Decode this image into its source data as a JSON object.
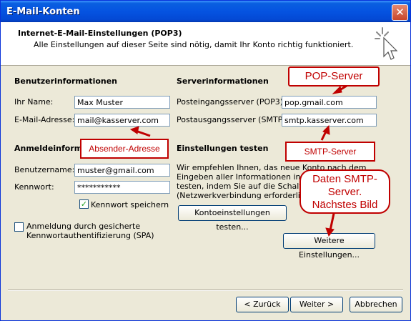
{
  "window": {
    "title": "E-Mail-Konten",
    "close_label": "✕"
  },
  "header": {
    "title": "Internet-E-Mail-Einstellungen (POP3)",
    "subtitle": "Alle Einstellungen auf dieser Seite sind nötig, damit Ihr Konto richtig funktioniert."
  },
  "user_info": {
    "heading": "Benutzerinformationen",
    "name_label": "Ihr Name:",
    "name_value": "Max Muster",
    "email_label": "E-Mail-Adresse:",
    "email_value": "mail@kasserver.com"
  },
  "server_info": {
    "heading": "Serverinformationen",
    "incoming_label": "Posteingangsserver (POP3):",
    "incoming_value": "pop.gmail.com",
    "outgoing_label": "Postausgangsserver (SMTP):",
    "outgoing_value": "smtp.kasserver.com"
  },
  "login_info": {
    "heading": "Anmeldeinforma",
    "username_label": "Benutzername:",
    "username_value": "muster@gmail.com",
    "password_label": "Kennwort:",
    "password_value": "***********",
    "remember_label": "Kennwort speichern",
    "spa_label_line1": "Anmeldung durch gesicherte",
    "spa_label_line2": "Kennwortauthentifizierung (SPA)"
  },
  "test_settings": {
    "heading": "Einstellungen testen",
    "text_line1": "Wir empfehlen Ihnen, das neue Konto nach dem",
    "text_line2": "Eingeben aller Informationen in die",
    "text_line3": "testen, indem Sie auf die Schaltflä",
    "text_line4": "(Netzwerkverbindung erforderlich).",
    "test_button": "Kontoeinstellungen testen...",
    "more_button": "Weitere Einstellungen..."
  },
  "footer": {
    "back_button": "< Zurück",
    "next_button": "Weiter >",
    "cancel_button": "Abbrechen"
  },
  "annotations": {
    "pop_server": "POP-Server",
    "sender_address": "Absender-Adresse",
    "smtp_server": "SMTP-Server",
    "smtp_data_line1": "Daten SMTP-",
    "smtp_data_line2": "Server.",
    "smtp_data_line3": "Nächstes Bild",
    "color": "#c00000"
  },
  "icons": {
    "header": "cursor-sparkle-icon",
    "check": "checkmark-icon"
  }
}
